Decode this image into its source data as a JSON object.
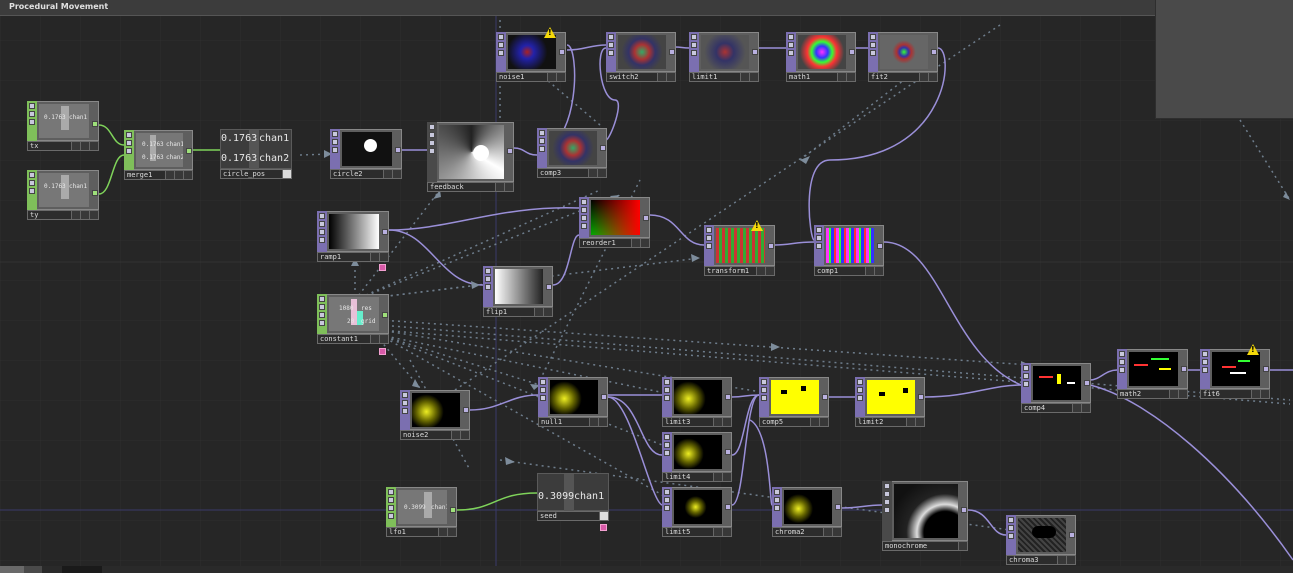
{
  "window": {
    "title": "Procedural Movement"
  },
  "nodes": {
    "tx": {
      "label": "tx",
      "value": "0.1763",
      "chan": "chan1"
    },
    "ty": {
      "label": "ty",
      "value": "0.1763",
      "chan": "chan1"
    },
    "merge1": {
      "label": "merge1",
      "value1": "0.1763",
      "chan1": "chan1",
      "value2": "0.1763",
      "chan2": "chan2"
    },
    "circle_pos": {
      "label": "circle_pos",
      "value1": "0.1763",
      "chan1": "chan1",
      "value2": "0.1763",
      "chan2": "chan2"
    },
    "circle2": {
      "label": "circle2"
    },
    "feedback": {
      "label": "feedback"
    },
    "noise1": {
      "label": "noise1"
    },
    "switch2": {
      "label": "switch2"
    },
    "limit1": {
      "label": "limit1"
    },
    "math1": {
      "label": "math1"
    },
    "fit2": {
      "label": "fit2"
    },
    "comp3": {
      "label": "comp3"
    },
    "ramp1": {
      "label": "ramp1"
    },
    "reorder1": {
      "label": "reorder1"
    },
    "transform1": {
      "label": "transform1"
    },
    "comp1": {
      "label": "comp1"
    },
    "flip1": {
      "label": "flip1"
    },
    "constant1": {
      "label": "constant1",
      "value1": "1080",
      "name1": "res",
      "value2": "20",
      "name2": "grid"
    },
    "noise2": {
      "label": "noise2"
    },
    "null1": {
      "label": "null1"
    },
    "limit3": {
      "label": "limit3"
    },
    "comp5": {
      "label": "comp5"
    },
    "limit2": {
      "label": "limit2"
    },
    "comp4": {
      "label": "comp4"
    },
    "math2": {
      "label": "math2"
    },
    "fit6": {
      "label": "fit6"
    },
    "limit4": {
      "label": "limit4"
    },
    "lfo1": {
      "label": "lfo1",
      "value": "0.3099",
      "chan": "chan1"
    },
    "seed": {
      "label": "seed",
      "value": "0.3099",
      "chan": "chan1"
    },
    "limit5": {
      "label": "limit5"
    },
    "chroma2": {
      "label": "chroma2"
    },
    "monochrome": {
      "label": "monochrome"
    },
    "chroma3": {
      "label": "chroma3"
    }
  },
  "colors": {
    "top_node": "#7b6fb0",
    "chop_node": "#7fbf5a",
    "wire_top": "#9a8fd8",
    "wire_chop": "#7fd35a",
    "warning": "#f5d90a"
  }
}
